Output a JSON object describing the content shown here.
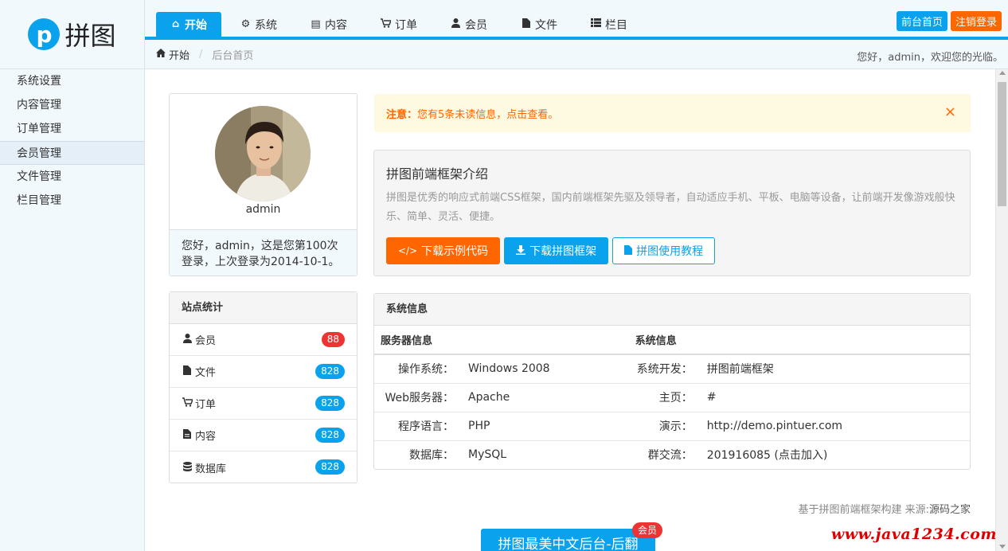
{
  "logo": {
    "letter": "p",
    "text": "拼图"
  },
  "tabs": [
    {
      "icon": "⌂",
      "label": "开始"
    },
    {
      "icon": "⚙",
      "label": "系统"
    },
    {
      "icon": "▤",
      "label": "内容"
    },
    {
      "icon": "🛒",
      "label": "订单"
    },
    {
      "icon": "●",
      "label": "会员"
    },
    {
      "icon": "▮",
      "label": "文件"
    },
    {
      "icon": "☰",
      "label": "栏目"
    }
  ],
  "top_buttons": {
    "home": "前台首页",
    "logout": "注销登录"
  },
  "breadcrumb": {
    "home": "开始",
    "current": "后台首页"
  },
  "greeting": "您好，admin，欢迎您的光临。",
  "sidebar": [
    {
      "label": "系统设置"
    },
    {
      "label": "内容管理"
    },
    {
      "label": "订单管理"
    },
    {
      "label": "会员管理"
    },
    {
      "label": "文件管理"
    },
    {
      "label": "栏目管理"
    }
  ],
  "profile": {
    "name": "admin",
    "welcome": "您好，admin，这是您第100次登录，上次登录为2014-10-1。"
  },
  "notice": {
    "prefix": "注意：",
    "text": "您有5条未读信息，点击查看。",
    "close": "×"
  },
  "intro": {
    "title": "拼图前端框架介绍",
    "desc": "拼图是优秀的响应式前端CSS框架，国内前端框架先驱及领导者，自动适应手机、平板、电脑等设备，让前端开发像游戏般快乐、简单、灵活、便捷。",
    "btn_code": "下载示例代码",
    "btn_download": "下载拼图框架",
    "btn_docs": "拼图使用教程"
  },
  "stats": {
    "title": "站点统计",
    "items": [
      {
        "label": "会员",
        "count": "88"
      },
      {
        "label": "文件",
        "count": "828"
      },
      {
        "label": "订单",
        "count": "828"
      },
      {
        "label": "内容",
        "count": "828"
      },
      {
        "label": "数据库",
        "count": "828"
      }
    ]
  },
  "sysinfo": {
    "title": "系统信息",
    "col1": "服务器信息",
    "col2": "系统信息",
    "rows": [
      {
        "k1": "操作系统：",
        "v1": "Windows 2008",
        "k2": "系统开发：",
        "v2": "拼图前端框架"
      },
      {
        "k1": "Web服务器：",
        "v1": "Apache",
        "k2": "主页：",
        "v2": "#"
      },
      {
        "k1": "程序语言：",
        "v1": "PHP",
        "k2": "演示：",
        "v2": "http://demo.pintuer.com"
      },
      {
        "k1": "数据库：",
        "v1": "MySQL",
        "k2": "群交流：",
        "v2": "201916085 (点击加入)"
      }
    ]
  },
  "footnote": {
    "text": "基于拼图前端框架构建 来源:",
    "source": "源码之家"
  },
  "promo": {
    "button": "拼图最美中文后台-后翻",
    "tag": "会员"
  },
  "watermark": "www.java1234.com",
  "colors": {
    "primary": "#0aa1ed",
    "accent": "#ff6600",
    "danger": "#ee3333"
  }
}
